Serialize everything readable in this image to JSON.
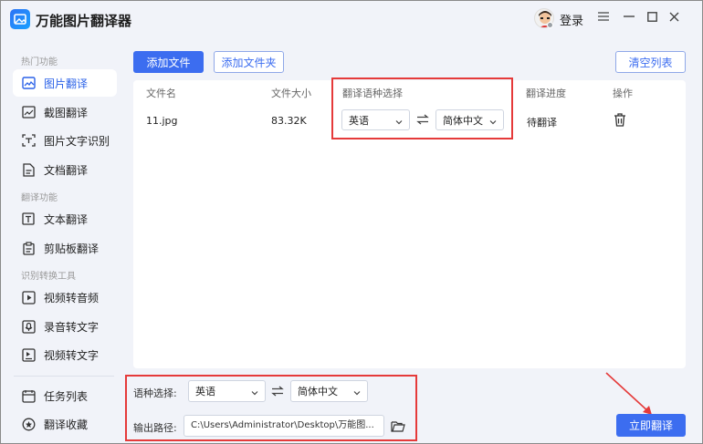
{
  "app": {
    "title": "万能图片翻译器",
    "login_label": "登录"
  },
  "sidebar": {
    "section_hot": "热门功能",
    "section_translate": "翻译功能",
    "section_convert": "识别转换工具",
    "items": [
      {
        "label": "图片翻译",
        "icon": "image-icon",
        "active": true
      },
      {
        "label": "截图翻译",
        "icon": "screenshot-icon"
      },
      {
        "label": "图片文字识别",
        "icon": "ocr-icon"
      },
      {
        "label": "文档翻译",
        "icon": "document-icon"
      },
      {
        "label": "文本翻译",
        "icon": "text-icon"
      },
      {
        "label": "剪贴板翻译",
        "icon": "clipboard-icon"
      },
      {
        "label": "视频转音频",
        "icon": "video-audio-icon"
      },
      {
        "label": "录音转文字",
        "icon": "recording-icon"
      },
      {
        "label": "视频转文字",
        "icon": "video-text-icon"
      },
      {
        "label": "任务列表",
        "icon": "task-list-icon"
      },
      {
        "label": "翻译收藏",
        "icon": "favorite-icon"
      }
    ]
  },
  "toolbar": {
    "add_file": "添加文件",
    "add_folder": "添加文件夹",
    "clear_list": "清空列表"
  },
  "table": {
    "headers": {
      "name": "文件名",
      "size": "文件大小",
      "lang": "翻译语种选择",
      "progress": "翻译进度",
      "action": "操作"
    },
    "rows": [
      {
        "name": "11.jpg",
        "size": "83.32K",
        "source_lang": "英语",
        "target_lang": "简体中文",
        "status": "待翻译"
      }
    ]
  },
  "bottom": {
    "lang_label": "语种选择:",
    "source_lang": "英语",
    "target_lang": "简体中文",
    "output_label": "输出路径:",
    "output_path": "C:\\Users\\Administrator\\Desktop\\万能图...",
    "translate_button": "立即翻译"
  },
  "colors": {
    "accent": "#3c6df0",
    "highlight_box": "#e53a3a"
  }
}
